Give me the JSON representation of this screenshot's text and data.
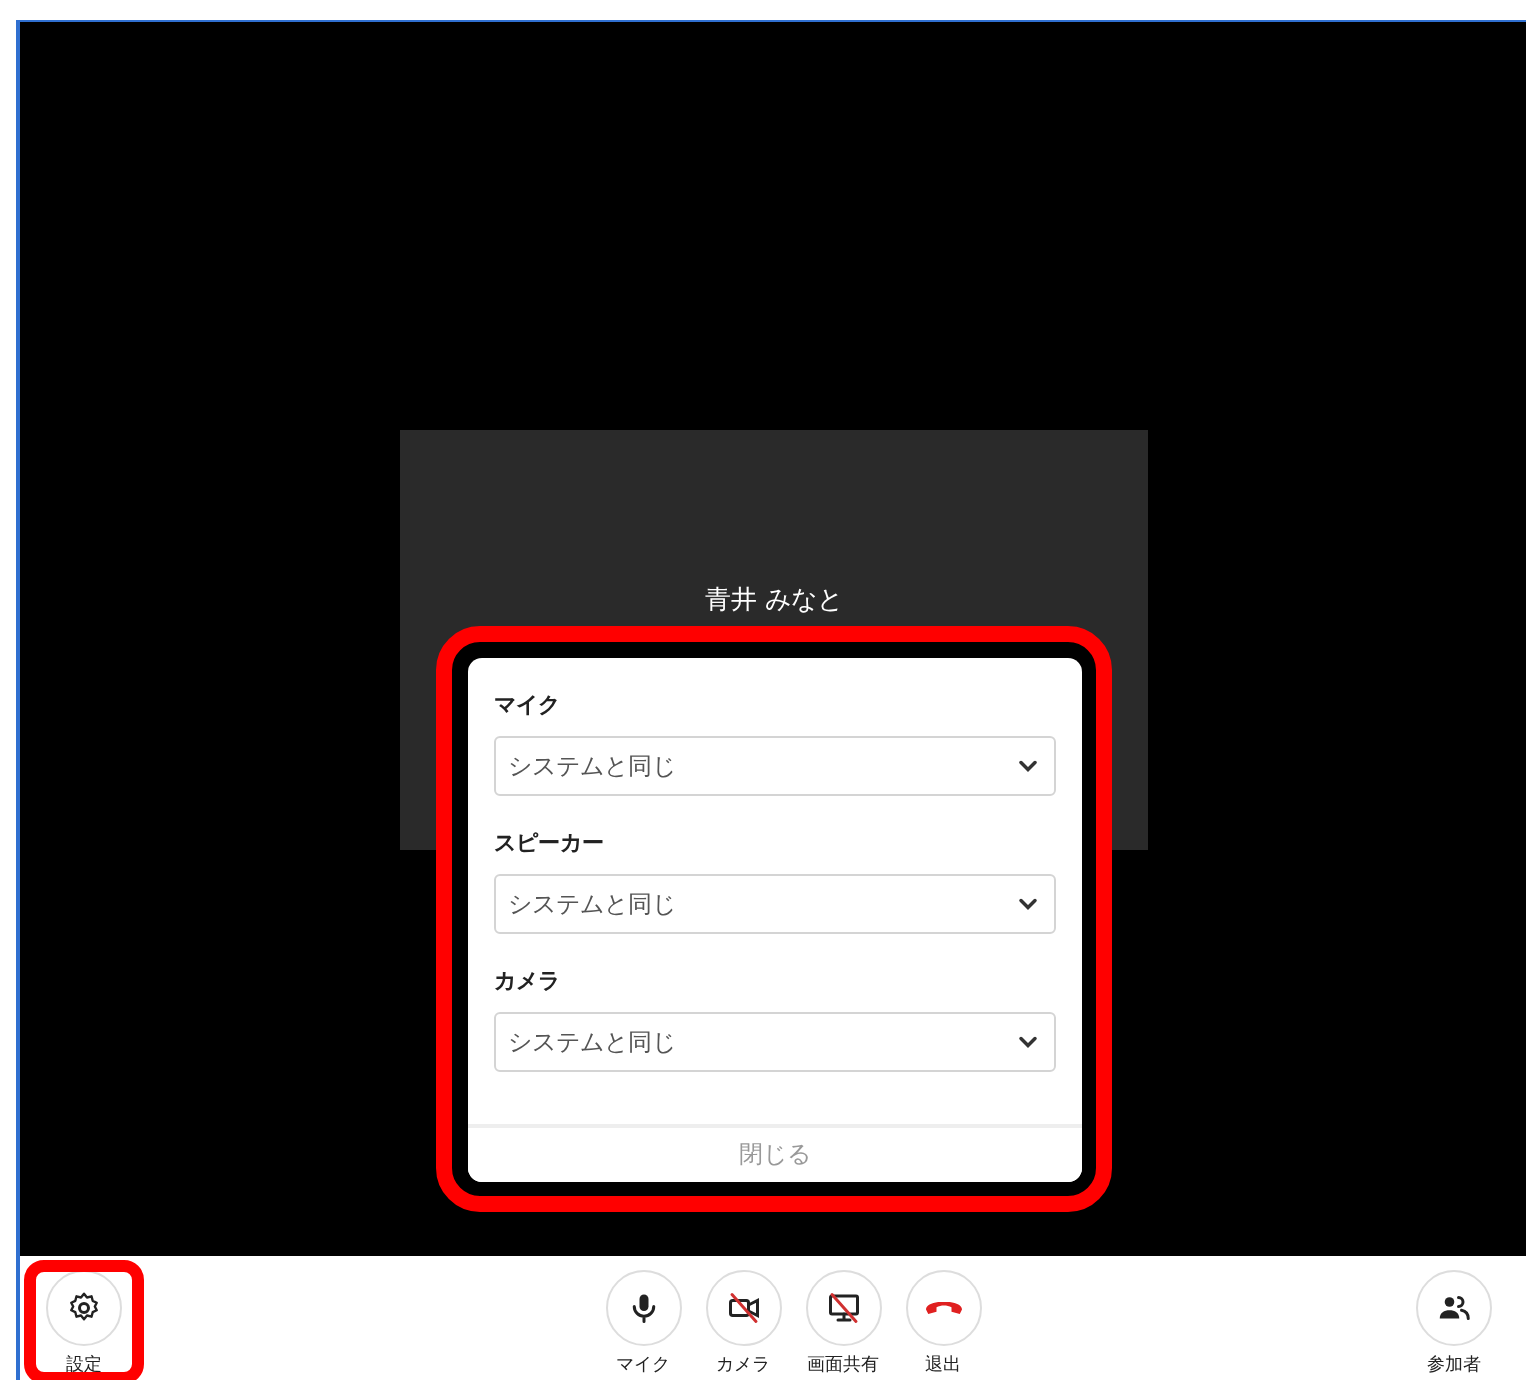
{
  "participant": {
    "name": "青井 みなと"
  },
  "settings_dialog": {
    "fields": [
      {
        "label": "マイク",
        "value": "システムと同じ"
      },
      {
        "label": "スピーカー",
        "value": "システムと同じ"
      },
      {
        "label": "カメラ",
        "value": "システムと同じ"
      }
    ],
    "close": "閉じる"
  },
  "toolbar": {
    "settings": {
      "label": "設定"
    },
    "controls": [
      {
        "kind": "mic",
        "label": "マイク",
        "off": false
      },
      {
        "kind": "camera",
        "label": "カメラ",
        "off": true
      },
      {
        "kind": "screen",
        "label": "画面共有",
        "off": true
      },
      {
        "kind": "leave",
        "label": "退出"
      }
    ],
    "participants": {
      "label": "参加者"
    }
  }
}
